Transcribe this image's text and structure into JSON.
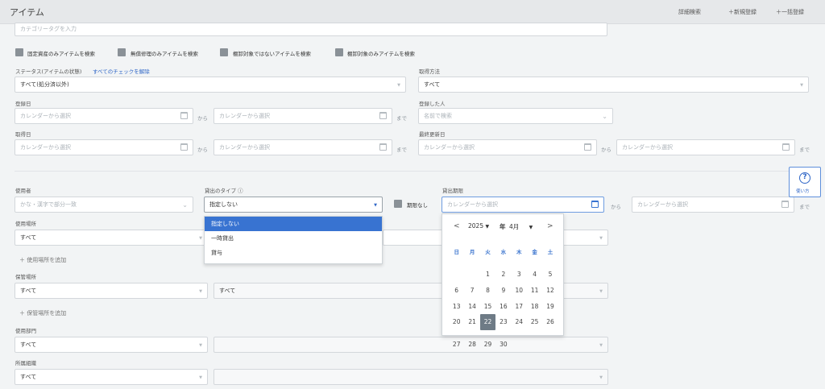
{
  "header": {
    "title": "アイテム",
    "detail_search": "詳細検索",
    "new_register": "＋新規登録",
    "bulk_register": "＋一括登録"
  },
  "category_tag": {
    "placeholder": "カテゴリータグを入力"
  },
  "checkboxes": [
    "固定資産のみアイテムを検索",
    "無償修理のみアイテムを検索",
    "棚卸対象ではないアイテムを検索",
    "棚卸対象のみアイテムを検索"
  ],
  "status": {
    "label": "ステータス(アイテムの状態)",
    "clear_link": "すべてのチェックを解除",
    "value": "すべて(処分済以外)"
  },
  "acquisition_method": {
    "label": "取得方法",
    "value": "すべて"
  },
  "registered_date": {
    "label": "登録日",
    "from_placeholder": "カレンダーから選択",
    "to_placeholder": "カレンダーから選択"
  },
  "registered_by": {
    "label": "登録した人",
    "placeholder": "名前で検索"
  },
  "acquired_date": {
    "label": "取得日",
    "from_placeholder": "カレンダーから選択",
    "to_placeholder": "カレンダーから選択"
  },
  "last_updated": {
    "label": "最終更新日",
    "from_placeholder": "カレンダーから選択",
    "to_placeholder": "カレンダーから選択"
  },
  "connectors": {
    "from": "から",
    "to": "まで"
  },
  "user": {
    "label": "使用者",
    "placeholder": "かな・漢字で部分一致"
  },
  "loan_type": {
    "label": "貸出のタイプ ⓘ",
    "value": "指定しない",
    "options": [
      "指定しない",
      "一時貸出",
      "貸与"
    ]
  },
  "no_deadline": {
    "label": "期限なし"
  },
  "loan_deadline": {
    "label": "貸出期限",
    "from_placeholder": "カレンダーから選択",
    "to_placeholder": "カレンダーから選択"
  },
  "use_location": {
    "label": "使用場所",
    "value": "すべて",
    "add": "＋ 使用場所を追加"
  },
  "storage_location": {
    "label": "保管場所",
    "value": "すべて",
    "value2": "すべて",
    "add": "＋ 保管場所を追加"
  },
  "use_department": {
    "label": "使用部門",
    "value": "すべて"
  },
  "organization": {
    "label": "所属組織",
    "value": "すべて"
  },
  "calendar": {
    "prev": "<",
    "next": ">",
    "year": "2025",
    "year_suffix": "年",
    "month": "4月",
    "today": 22,
    "weekdays": [
      "日",
      "月",
      "火",
      "水",
      "木",
      "金",
      "土"
    ],
    "weeks": [
      [
        "",
        "",
        "1",
        "2",
        "3",
        "4",
        "5"
      ],
      [
        "6",
        "7",
        "8",
        "9",
        "10",
        "11",
        "12"
      ],
      [
        "13",
        "14",
        "15",
        "16",
        "17",
        "18",
        "19"
      ],
      [
        "20",
        "21",
        "22",
        "23",
        "24",
        "25",
        "26"
      ],
      [
        "27",
        "28",
        "29",
        "30",
        "",
        "",
        ""
      ]
    ]
  },
  "help": {
    "label": "使い方"
  },
  "colors": {
    "accent": "#3873d1",
    "today": "#6e7b86",
    "checkbox": "#8a9197"
  }
}
